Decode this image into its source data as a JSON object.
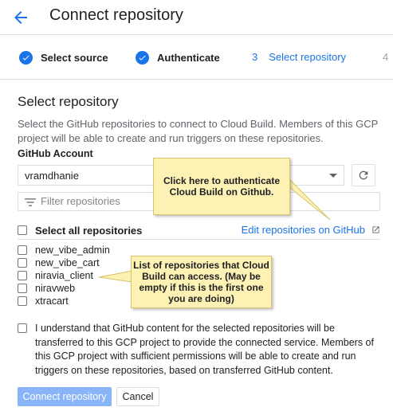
{
  "header": {
    "title": "Connect repository"
  },
  "stepper": {
    "steps": [
      {
        "label": "Select source",
        "state": "done"
      },
      {
        "label": "Authenticate",
        "state": "done"
      },
      {
        "number": "3",
        "label": "Select repository",
        "state": "active"
      },
      {
        "number": "4",
        "state": "pending"
      }
    ]
  },
  "main": {
    "section_title": "Select repository",
    "description": "Select the GitHub repositories to connect to Cloud Build. Members of this GCP project will be able to create and run triggers on these repositories.",
    "account_label": "GitHub Account",
    "account_value": "vramdhanie",
    "filter_placeholder": "Filter repositories",
    "select_all_label": "Select all repositories",
    "edit_link": "Edit repositories on GitHub",
    "repositories": [
      "new_vibe_admin",
      "new_vibe_cart",
      "niravia_client",
      "niravweb",
      "xtracart"
    ],
    "agreement": "I understand that GitHub content for the selected repositories will be transferred to this GCP project to provide the connected service. Members of this GCP project with sufficient permissions will be able to create and run triggers on these repositories, based on transferred GitHub content.",
    "connect_button": "Connect repository",
    "cancel_button": "Cancel"
  },
  "callouts": {
    "authenticate": "Click here to authenticate Cloud Build on Github.",
    "repo_list": "List of repositories that Cloud Build can access. (May be empty if this is the first one you are doing)"
  },
  "colors": {
    "accent": "#1a73e8",
    "connect_disabled": "#8ab4f8",
    "callout_bg": "#fdf2b4"
  }
}
